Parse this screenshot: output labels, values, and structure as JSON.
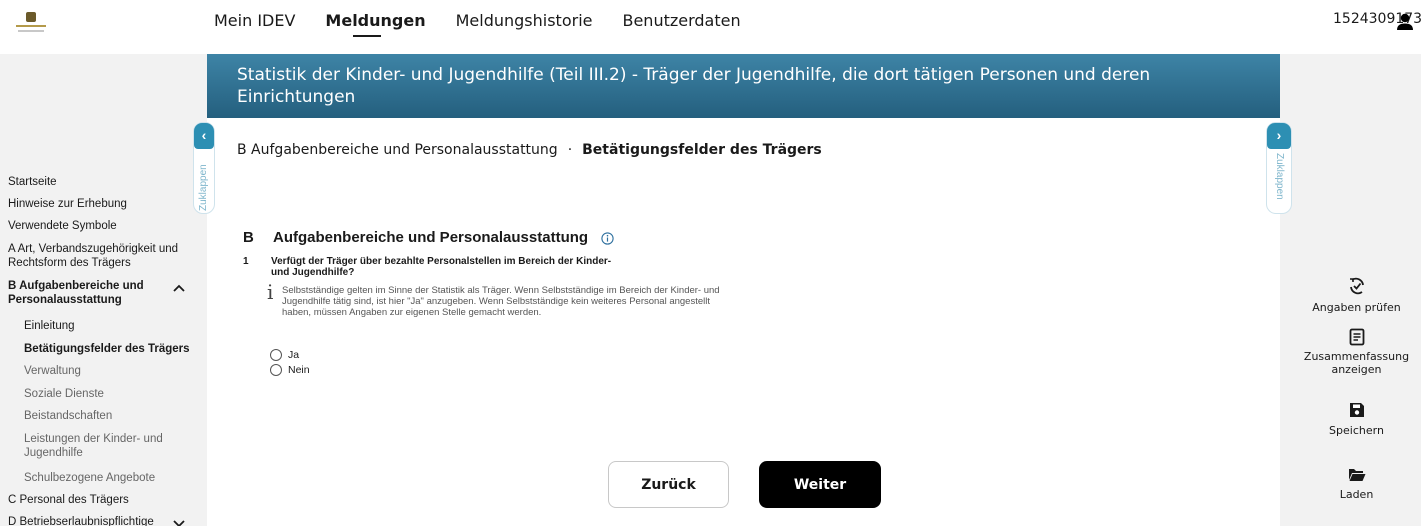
{
  "topbar": {
    "logo_icon": "state-crest-logo",
    "nav": [
      {
        "label": "Mein IDEV",
        "active": false
      },
      {
        "label": "Meldungen",
        "active": true
      },
      {
        "label": "Meldungshistorie",
        "active": false
      },
      {
        "label": "Benutzerdaten",
        "active": false
      }
    ],
    "user_id": "1524309173",
    "user_icon": "person-icon"
  },
  "sidebar": {
    "items": [
      {
        "label": "Startseite"
      },
      {
        "label": "Hinweise zur Erhebung"
      },
      {
        "label": "Verwendete Symbole"
      },
      {
        "label": "A Art, Verbandszugehörigkeit und Rechtsform des Trägers"
      },
      {
        "label": "B Aufgabenbereiche und Personalausstattung"
      },
      {
        "label": "Einleitung"
      },
      {
        "label": "Betätigungsfelder des Trägers"
      },
      {
        "label": "Verwaltung"
      },
      {
        "label": "Soziale Dienste"
      },
      {
        "label": "Beistandschaften"
      },
      {
        "label": "Leistungen der Kinder- und Jugendhilfe"
      },
      {
        "label": "Schulbezogene Angebote"
      },
      {
        "label": "C Personal des Trägers"
      },
      {
        "label": "D Betriebserlaubnispflichtige"
      }
    ],
    "collapse_label": "Zuklappen"
  },
  "header": {
    "title": "Statistik der Kinder- und Jugendhilfe (Teil III.2) - Träger der Jugendhilfe, die dort tätigen Personen und deren Einrichtungen"
  },
  "breadcrumb": {
    "parent": "B Aufgabenbereiche und Personalausstattung",
    "separator": "·",
    "current": "Betätigungsfelder des Trägers"
  },
  "section": {
    "letter": "B",
    "title": "Aufgabenbereiche und Personalausstattung",
    "question_number": "1",
    "question_text": "Verfügt der Träger über bezahlte Personalstellen im Bereich der Kinder- und Jugendhilfe?",
    "hint_glyph": "i",
    "hint_text": "Selbstständige gelten im Sinne der Statistik als Träger. Wenn Selbstständige im Bereich der Kinder- und Jugendhilfe tätig sind, ist hier \"Ja\" anzugeben. Wenn Selbstständige kein weiteres Personal angestellt haben, müssen Angaben zur eigenen Stelle gemacht werden.",
    "options": [
      {
        "label": "Ja",
        "checked": false
      },
      {
        "label": "Nein",
        "checked": false
      }
    ]
  },
  "buttons": {
    "back": "Zurück",
    "next": "Weiter"
  },
  "actions": [
    {
      "icon": "check-refresh-icon",
      "label": "Angaben prüfen"
    },
    {
      "icon": "summary-document-icon",
      "label": "Zusammenfassung anzeigen"
    },
    {
      "icon": "save-disk-icon",
      "label": "Speichern"
    },
    {
      "icon": "folder-open-icon",
      "label": "Laden"
    }
  ],
  "colors": {
    "header_band": "#2e6f92",
    "collapse_button": "#2d8fb3",
    "primary_button": "#000000"
  }
}
